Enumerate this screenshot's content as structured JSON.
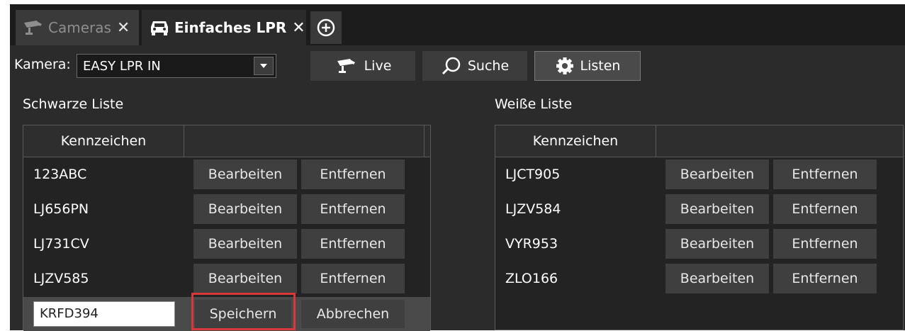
{
  "tabs": [
    {
      "label": "Cameras",
      "icon": "cctv-camera-icon"
    },
    {
      "label": "Einfaches LPR",
      "icon": "car-icon"
    }
  ],
  "toolbar": {
    "camera_label": "Kamera:",
    "camera_value": "EASY LPR IN",
    "live_label": "Live",
    "search_label": "Suche",
    "lists_label": "Listen"
  },
  "blacklist": {
    "title": "Schwarze Liste",
    "column": "Kennzeichen",
    "rows": [
      "123ABC",
      "LJ656PN",
      "LJ731CV",
      "LJZV585"
    ],
    "edit_label": "Bearbeiten",
    "remove_label": "Entfernen",
    "edit_value": "KRFD394",
    "save_label": "Speichern",
    "cancel_label": "Abbrechen"
  },
  "whitelist": {
    "title": "Weiße Liste",
    "column": "Kennzeichen",
    "rows": [
      "LJCT905",
      "LJZV584",
      "VYR953",
      "ZLO166"
    ],
    "edit_label": "Bearbeiten",
    "remove_label": "Entfernen"
  },
  "colors": {
    "highlight": "#d9383a",
    "background": "#2b2b2b"
  }
}
